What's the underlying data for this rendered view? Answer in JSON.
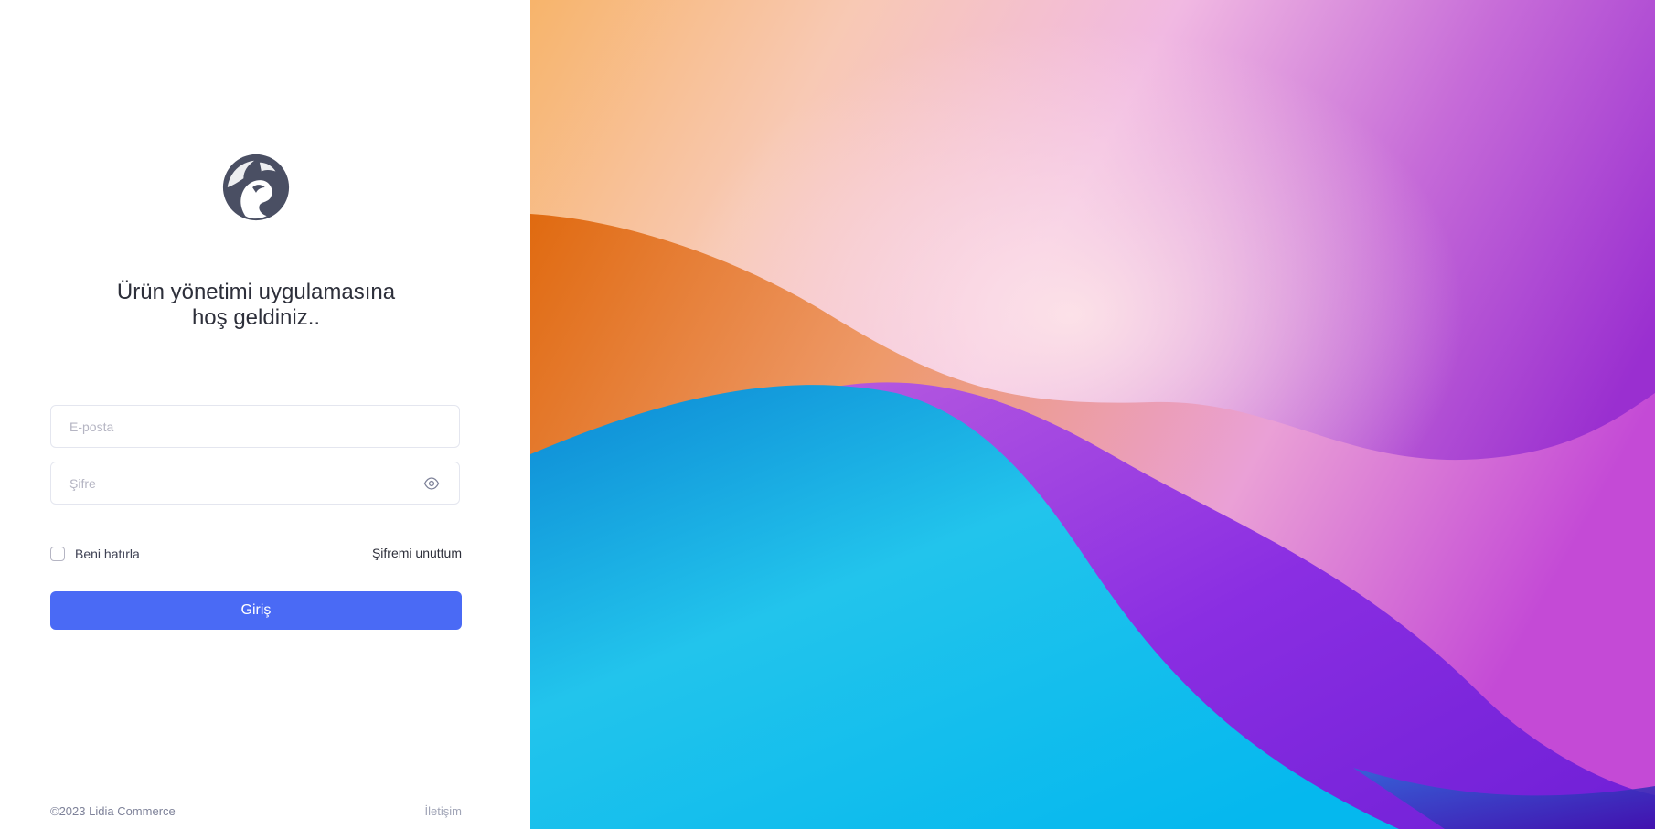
{
  "welcome": {
    "line1": "Ürün yönetimi uygulamasına",
    "line2": "hoş geldiniz.."
  },
  "form": {
    "email_placeholder": "E-posta",
    "email_value": "",
    "password_placeholder": "Şifre",
    "password_value": "",
    "remember_label": "Beni hatırla",
    "remember_checked": false,
    "forgot_label": "Şifremi unuttum",
    "submit_label": "Giriş"
  },
  "footer": {
    "copyright": "©2023 Lidia Commerce",
    "contact_label": "İletişim"
  },
  "icons": {
    "logo": "lion-logo-icon",
    "password_toggle": "eye-icon"
  },
  "colors": {
    "accent": "#4a6af5",
    "logo": "#4a4f63"
  }
}
